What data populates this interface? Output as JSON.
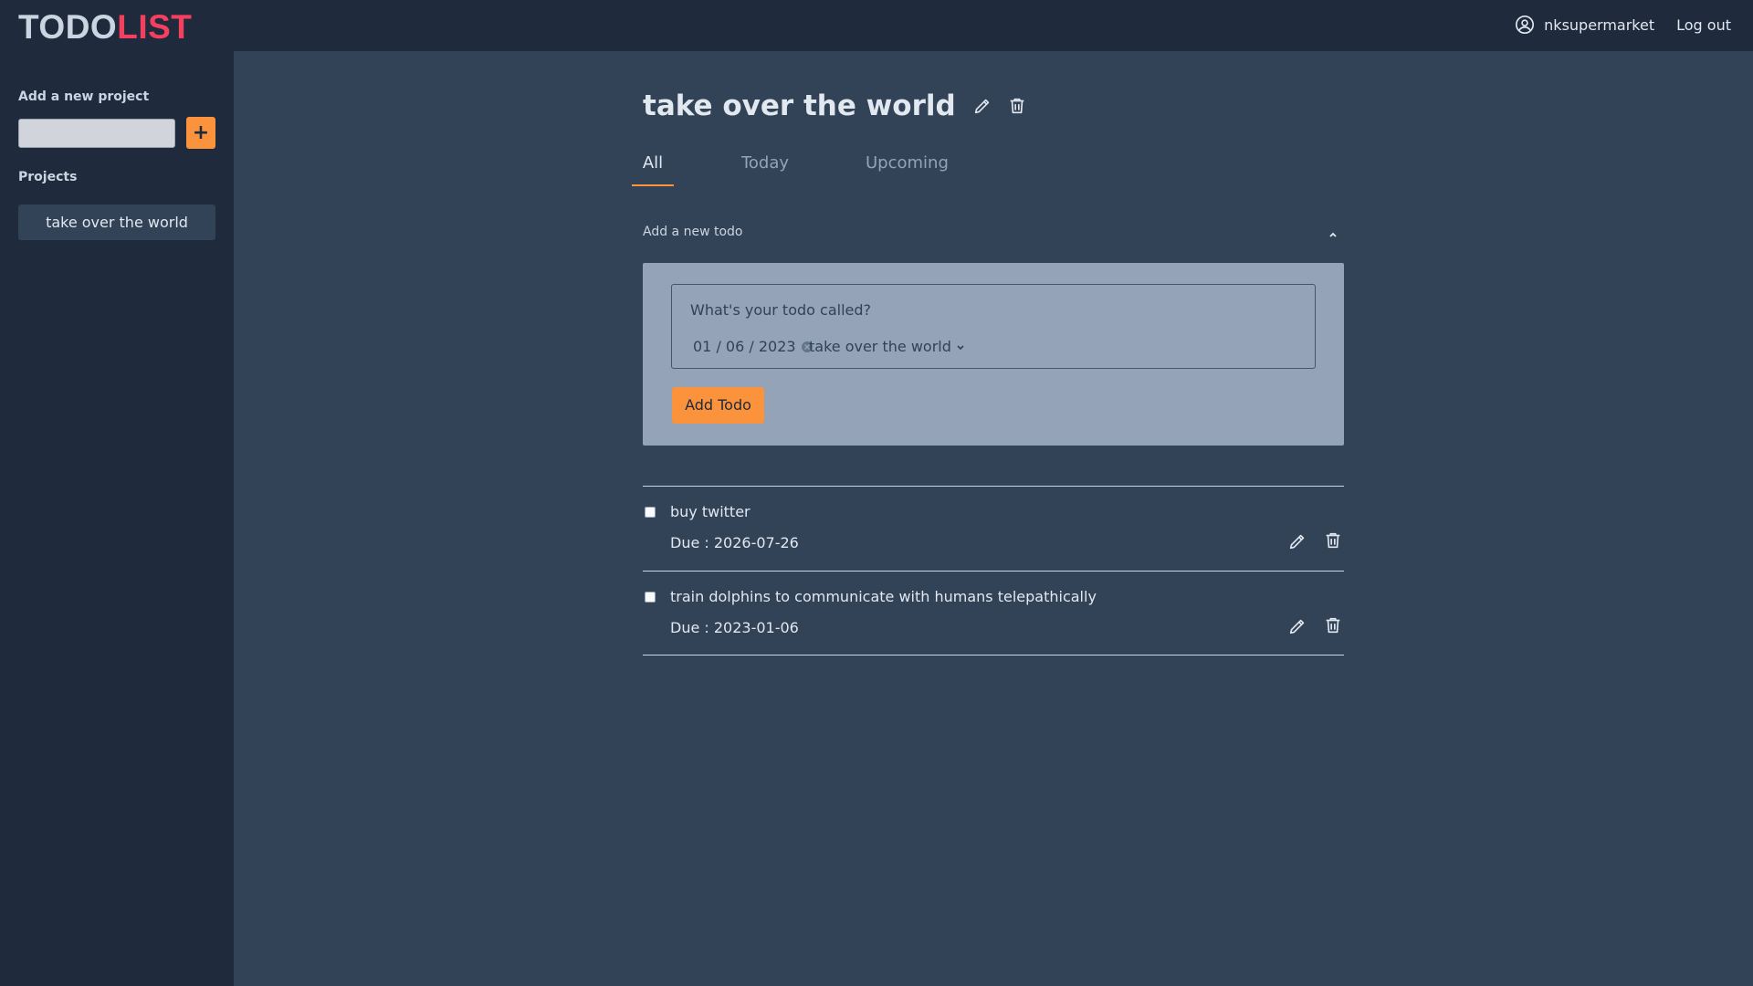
{
  "brand": {
    "part1": "TODO",
    "part2": "LIST"
  },
  "header": {
    "username": "nksupermarket",
    "logout_label": "Log out"
  },
  "sidebar": {
    "add_project_label": "Add a new project",
    "add_project_button": "+",
    "projects_label": "Projects",
    "projects": [
      {
        "label": "take over the world"
      }
    ]
  },
  "main": {
    "title": "take over the world",
    "tabs": [
      {
        "label": "All",
        "active": true
      },
      {
        "label": "Today",
        "active": false
      },
      {
        "label": "Upcoming",
        "active": false
      }
    ],
    "add_todo": {
      "section_label": "Add a new todo",
      "name_placeholder": "What's your todo called?",
      "date_value": "01 / 06 / 2023",
      "project_value": "take over the world",
      "button_label": "Add Todo"
    },
    "todos": [
      {
        "title": "buy twitter",
        "due": "Due : 2026-07-26",
        "checked": false
      },
      {
        "title": "train dolphins to communicate with humans telepathically",
        "due": "Due : 2023-01-06",
        "checked": false
      }
    ]
  },
  "colors": {
    "background": "#324257",
    "sidebar": "#1f2a3c",
    "accent": "#fb923c",
    "brand_red": "#f43f5e",
    "panel": "#94a3b8"
  }
}
